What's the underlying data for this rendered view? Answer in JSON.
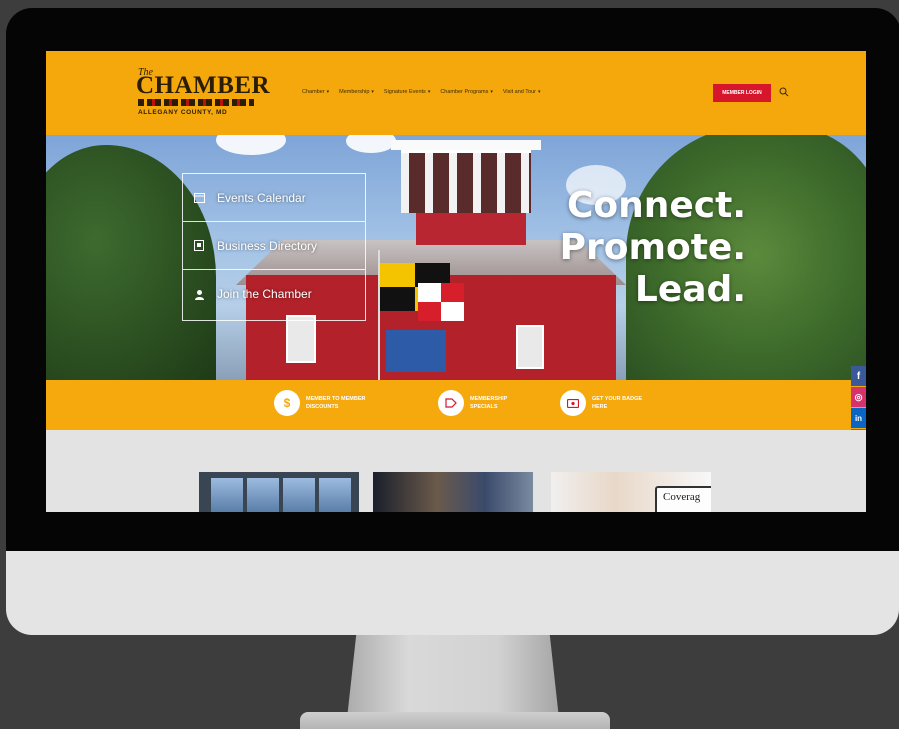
{
  "logo": {
    "the": "The",
    "main": "CHAMBER",
    "sub": "ALLEGANY COUNTY, MD"
  },
  "nav": {
    "items": [
      {
        "label": "Chamber"
      },
      {
        "label": "Membership"
      },
      {
        "label": "Signature Events"
      },
      {
        "label": "Chamber Programs"
      },
      {
        "label": "Visit and Tour"
      }
    ],
    "member_login": "MEMBER LOGIN",
    "search_icon": "search-icon"
  },
  "hero": {
    "quicklinks": [
      {
        "label": "Events Calendar",
        "icon": "calendar-icon"
      },
      {
        "label": "Business Directory",
        "icon": "directory-icon"
      },
      {
        "label": "Join the Chamber",
        "icon": "person-icon"
      }
    ],
    "tagline": [
      "Connect.",
      "Promote.",
      "Lead."
    ]
  },
  "features": [
    {
      "label": "MEMBER TO MEMBER DISCOUNTS",
      "icon": "dollar-icon"
    },
    {
      "label": "MEMBERSHIP SPECIALS",
      "icon": "tag-icon"
    },
    {
      "label": "GET YOUR BADGE HERE",
      "icon": "ticket-icon"
    }
  ],
  "social": [
    {
      "name": "facebook",
      "glyph": "f",
      "color": "#3b5998"
    },
    {
      "name": "instagram",
      "glyph": "◎",
      "color": "#d6336c"
    },
    {
      "name": "linkedin",
      "glyph": "in",
      "color": "#0a66c2"
    },
    {
      "name": "phone",
      "glyph": "✆",
      "color": "#6f6f6f"
    }
  ],
  "cards": {
    "coverage_text": "Coverag"
  },
  "colors": {
    "header_bg": "#f4a80c",
    "accent_red": "#d7152b",
    "feature_bar": "#f5a90d"
  }
}
